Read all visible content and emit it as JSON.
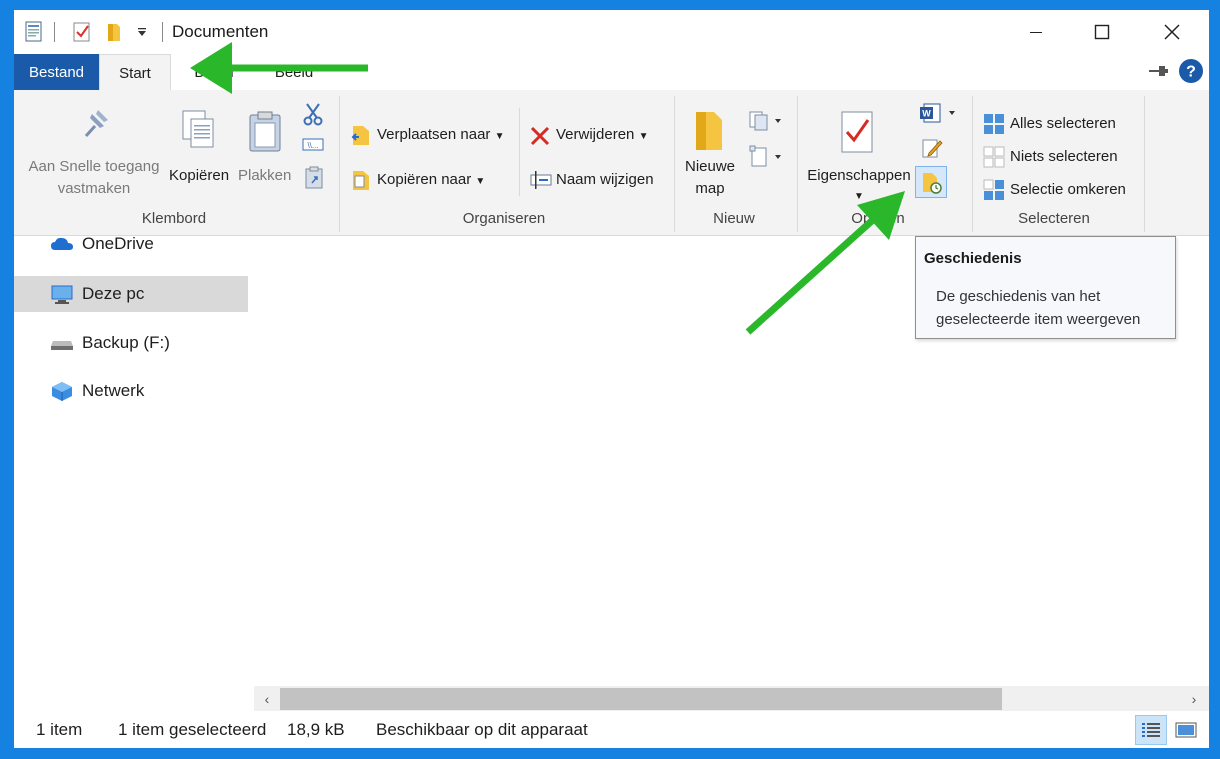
{
  "window": {
    "title": "Documenten"
  },
  "window_controls": {
    "minimize_icon": "minimize-icon",
    "maximize_icon": "maximize-icon",
    "close_icon": "close-icon"
  },
  "tabs": [
    {
      "label": "Bestand"
    },
    {
      "label": "Start"
    },
    {
      "label": "Delen"
    },
    {
      "label": "Beeld"
    }
  ],
  "ribbon": {
    "klembord": {
      "label": "Klembord",
      "pin": "Aan Snelle toegang vastmaken",
      "pin_line1": "Aan Snelle toegang",
      "pin_line2": "vastmaken",
      "copy": "Kopiëren",
      "paste": "Plakken"
    },
    "organiseren": {
      "label": "Organiseren",
      "move_to": "Verplaatsen naar",
      "copy_to": "Kopiëren naar",
      "delete": "Verwijderen",
      "rename": "Naam wijzigen"
    },
    "nieuw": {
      "label": "Nieuw",
      "new_folder_line1": "Nieuwe",
      "new_folder_line2": "map"
    },
    "openen": {
      "label": "Openen",
      "properties": "Eigenschappen"
    },
    "selecteren": {
      "label": "Selecteren",
      "select_all": "Alles selecteren",
      "select_none": "Niets selecteren",
      "invert": "Selectie omkeren"
    }
  },
  "nav": {
    "items": [
      {
        "label": "OneDrive"
      },
      {
        "label": "Deze pc"
      },
      {
        "label": "Backup (F:)"
      },
      {
        "label": "Netwerk"
      }
    ]
  },
  "tooltip": {
    "title": "Geschiedenis",
    "body": "De geschiedenis van het geselecteerde item weergeven"
  },
  "status": {
    "count": "1 item",
    "selected": "1 item geselecteerd",
    "size": "18,9 kB",
    "availability": "Beschikbaar op dit apparaat"
  },
  "colors": {
    "desktop": "#1581e0",
    "file_tab": "#1a5aa8",
    "annotation_arrow": "#2ab82a"
  }
}
